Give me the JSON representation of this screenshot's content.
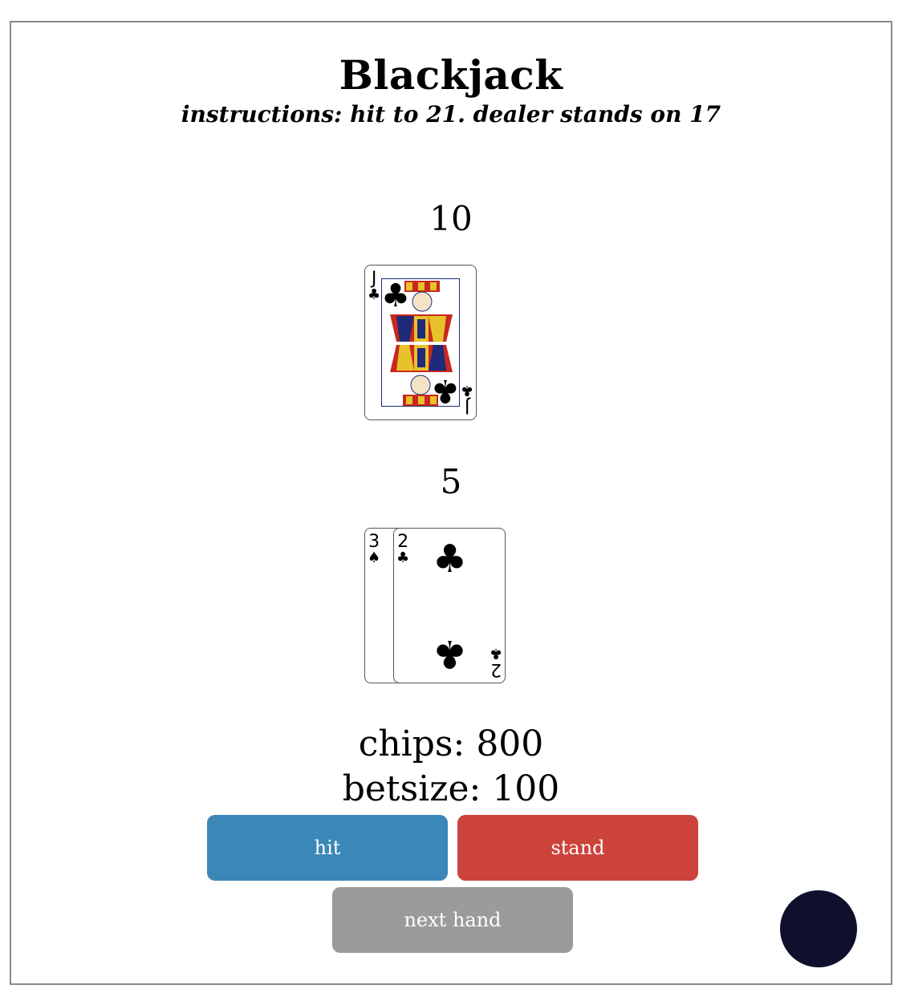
{
  "title": "Blackjack",
  "subtitle": "instructions: hit to 21. dealer stands on 17",
  "dealer": {
    "score": "10",
    "cards": [
      {
        "rank": "J",
        "suit": "♣",
        "suit_name": "clubs",
        "face": "jack-of-clubs"
      }
    ]
  },
  "player": {
    "score": "5",
    "cards": [
      {
        "rank": "3",
        "suit": "♠",
        "suit_name": "spades"
      },
      {
        "rank": "2",
        "suit": "♣",
        "suit_name": "clubs"
      }
    ]
  },
  "stats": {
    "chips": "chips: 800",
    "betsize": "betsize: 100"
  },
  "buttons": {
    "hit": "hit",
    "stand": "stand",
    "next_hand": "next hand"
  },
  "colors": {
    "hit": "#3a87b8",
    "stand": "#cc433b",
    "next_hand": "#9b9b9b",
    "fab": "#0f102b"
  }
}
